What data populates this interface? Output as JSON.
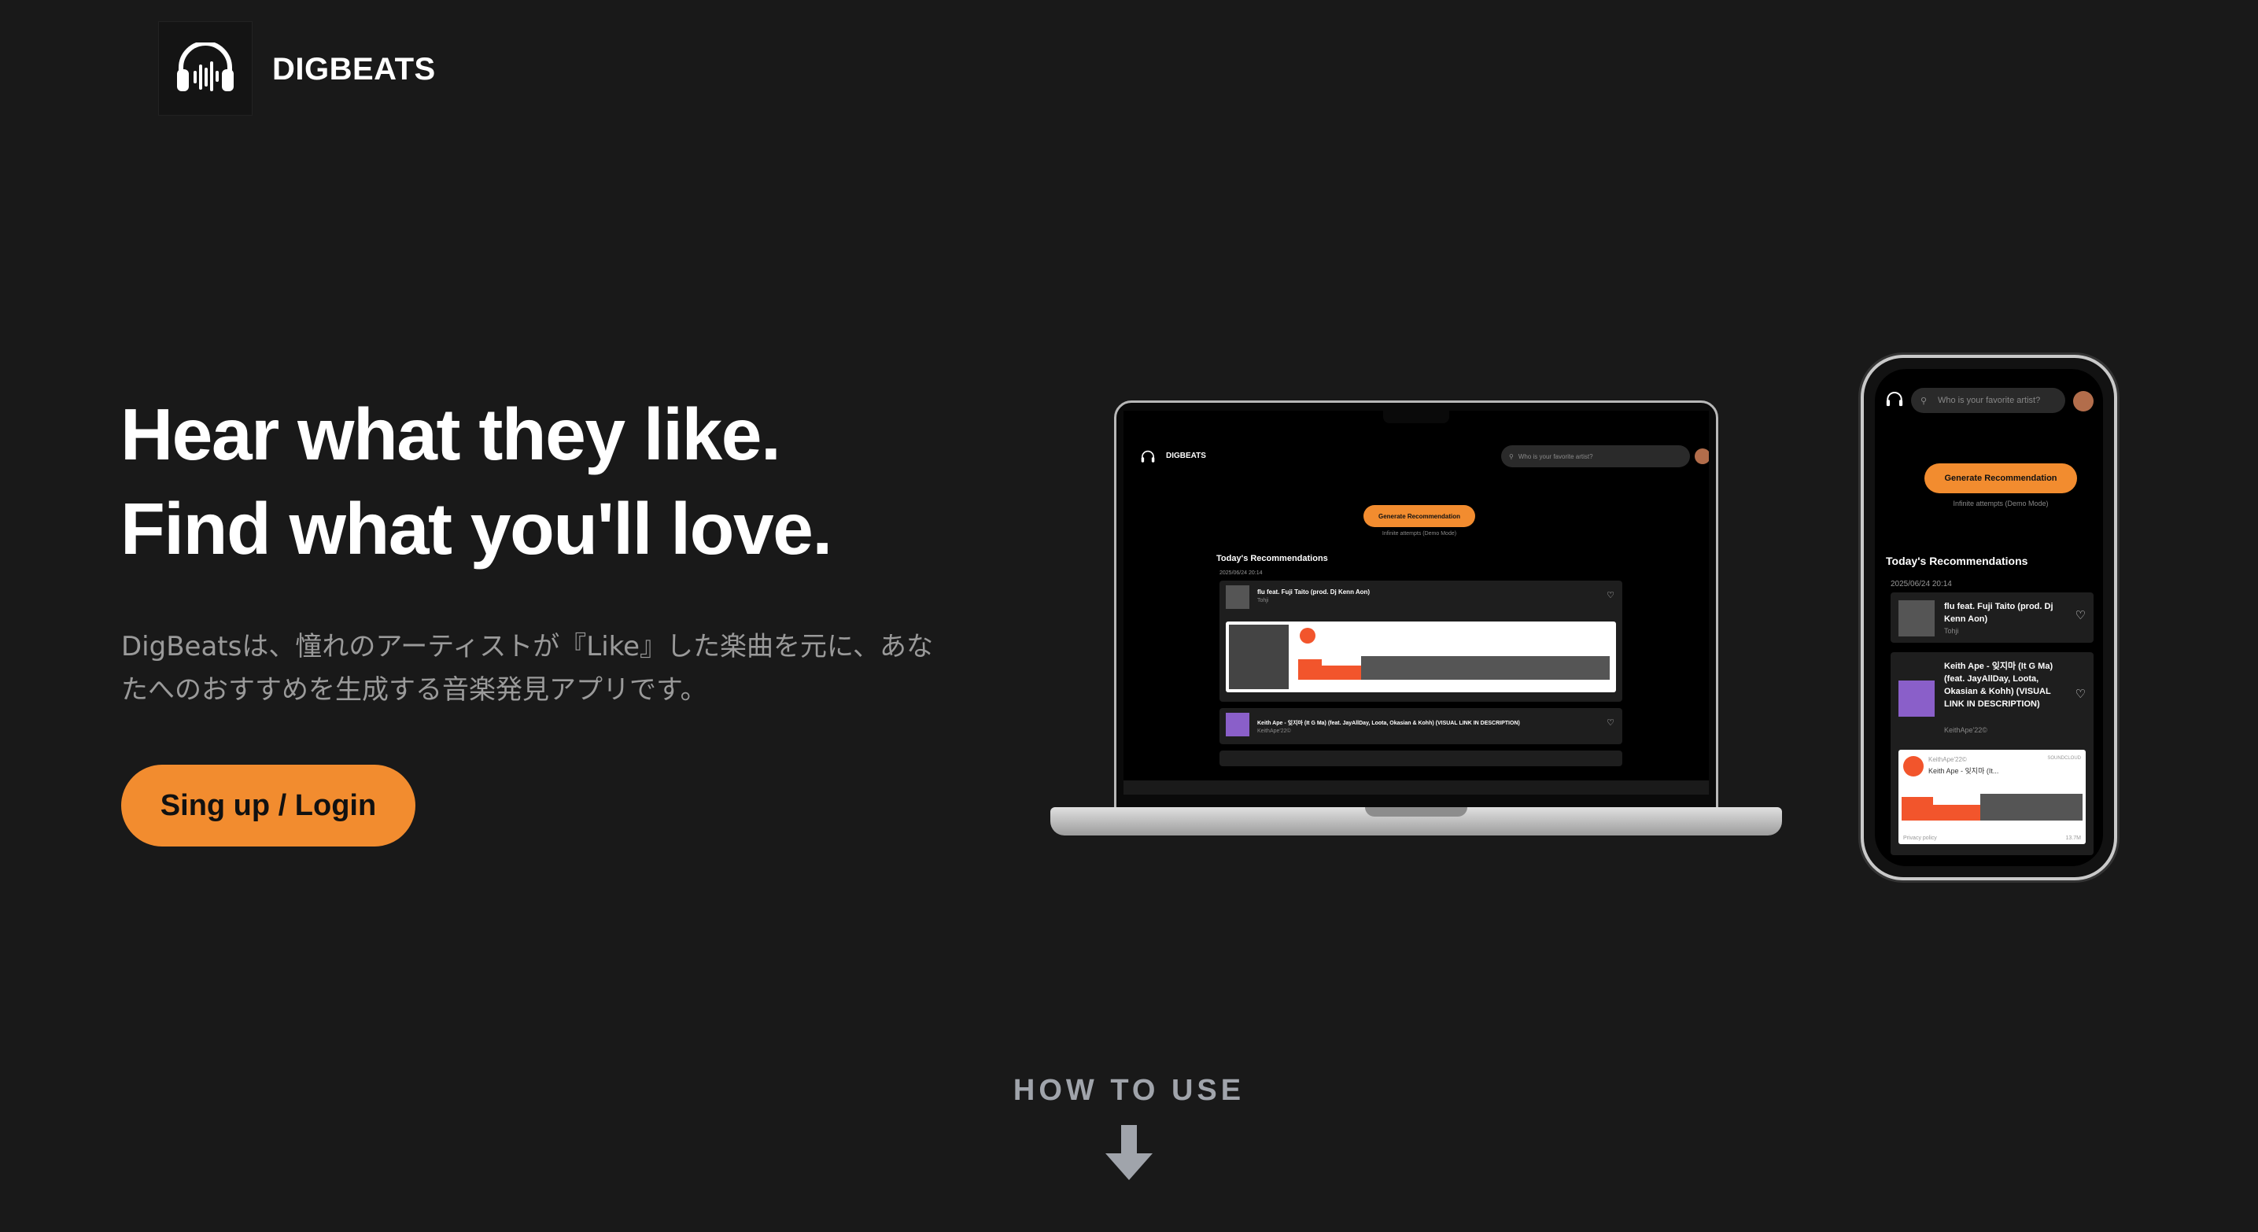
{
  "header": {
    "brand": "DIGBEATS"
  },
  "hero": {
    "title_line1": "Hear what they like.",
    "title_line2": "Find what you'll love.",
    "description": "DigBeatsは、憧れのアーティストが『Like』した楽曲を元に、あなたへのおすすめを生成する音楽発見アプリです。",
    "cta_label": "Sing up / Login"
  },
  "how_to_use": {
    "label": "HOW TO USE"
  },
  "laptop_app": {
    "brand": "DIGBEATS",
    "search_placeholder": "Who is your favorite artist?",
    "generate_label": "Generate Recommendation",
    "attempts_text": "Infinite attempts (Demo Mode)",
    "section_title": "Today's Recommendations",
    "date": "2025/06/24 20:14",
    "tracks": [
      {
        "title": "flu feat. Fuji Taito (prod. Dj Kenn Aon)",
        "artist": "Tohji"
      },
      {
        "title": "Keith Ape - 잊지마 (It G Ma) (feat. JayAllDay, Loota, Okasian & Kohh) (VISUAL LINK IN DESCRIPTION)",
        "artist": "KeithApe'22©"
      }
    ]
  },
  "phone_app": {
    "search_placeholder": "Who is your favorite artist?",
    "generate_label": "Generate Recommendation",
    "attempts_text": "Infinite attempts (Demo Mode)",
    "section_title": "Today's Recommendations",
    "date": "2025/06/24 20:14",
    "tracks": [
      {
        "title": "flu feat. Fuji Taito (prod. Dj Kenn Aon)",
        "artist": "Tohji"
      },
      {
        "title": "Keith Ape - 잊지마 (It G Ma) (feat. JayAllDay, Loota, Okasian & Kohh) (VISUAL LINK IN DESCRIPTION)",
        "artist": "KeithApe'22©"
      }
    ],
    "player": {
      "uploader": "KeithApe'22©",
      "track": "Keith Ape - 잊지마 (It...",
      "source": "SOUNDCLOUD",
      "footer": "Privacy policy",
      "plays": "13.7M"
    }
  },
  "colors": {
    "accent": "#f28c2f",
    "background": "#191919"
  },
  "icons": {
    "logo": "headphones-icon",
    "arrow": "arrow-down-icon"
  }
}
